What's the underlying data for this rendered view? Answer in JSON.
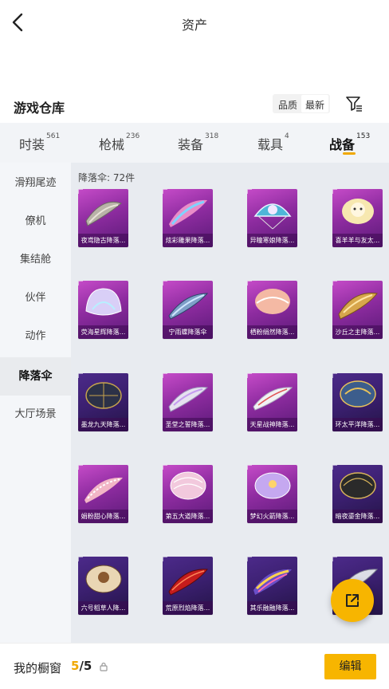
{
  "header": {
    "title": "资产",
    "back_icon": "chevron-left-icon"
  },
  "section": {
    "title": "游戏仓库",
    "sort_options": [
      "品质",
      "最新"
    ],
    "sort_active": "最新",
    "filter_icon": "filter-icon"
  },
  "tabs": [
    {
      "label": "时装",
      "count": "561"
    },
    {
      "label": "枪械",
      "count": "236"
    },
    {
      "label": "装备",
      "count": "318"
    },
    {
      "label": "载具",
      "count": "4"
    },
    {
      "label": "战备",
      "count": "153",
      "active": true
    }
  ],
  "sidebar": [
    {
      "label": "滑翔尾迹"
    },
    {
      "label": "僚机"
    },
    {
      "label": "集结舱"
    },
    {
      "label": "伙伴"
    },
    {
      "label": "动作"
    },
    {
      "label": "降落伞",
      "active": true
    },
    {
      "label": "大厅场景"
    }
  ],
  "content": {
    "count_label": "降落伞: 72件",
    "items": [
      {
        "name": "夜鸢隐古降落...",
        "style": "purple",
        "art": "glider-gray"
      },
      {
        "name": "炫彩雕果降落...",
        "style": "purple",
        "art": "glider-pink"
      },
      {
        "name": "异瞳寒娘降落...",
        "style": "purple",
        "art": "dome-cyan"
      },
      {
        "name": "喜羊羊与友太...",
        "style": "purple",
        "art": "dome-sheep"
      },
      {
        "name": "荧海星辉降落...",
        "style": "purple",
        "art": "shell-pearl"
      },
      {
        "name": "宁雨蝶降落伞",
        "style": "purple",
        "art": "glider-blue"
      },
      {
        "name": "栖粉绢然降落...",
        "style": "purple",
        "art": "dome-peach"
      },
      {
        "name": "沙丘之主降落...",
        "style": "purple",
        "art": "glider-gold"
      },
      {
        "name": "墨龙九天降落...",
        "style": "dark",
        "art": "dome-dark"
      },
      {
        "name": "圣堂之誓降落...",
        "style": "purple",
        "art": "glider-white"
      },
      {
        "name": "天星战神降落...",
        "style": "purple",
        "art": "glider-white2"
      },
      {
        "name": "环太平洋降落...",
        "style": "dark",
        "art": "dome-jaeger"
      },
      {
        "name": "娟粉甜心降落...",
        "style": "purple",
        "art": "glider-pinkstripe"
      },
      {
        "name": "第五大道降落...",
        "style": "purple",
        "art": "dome-pink"
      },
      {
        "name": "梦幻火箭降落...",
        "style": "purple",
        "art": "dome-dream"
      },
      {
        "name": "暗夜鎏金降落...",
        "style": "dark",
        "art": "dome-blackgold"
      },
      {
        "name": "六号稻草人降...",
        "style": "dark",
        "art": "dome-scarecrow"
      },
      {
        "name": "荒原烈焰降落...",
        "style": "dark",
        "art": "glider-red"
      },
      {
        "name": "其乐融融降落...",
        "style": "dark",
        "art": "glider-colorful"
      },
      {
        "name": "",
        "style": "dark",
        "art": "glider-silver"
      }
    ]
  },
  "fab": {
    "icon": "share-external-icon"
  },
  "bottom": {
    "showcase_label": "我的橱窗",
    "showcase_current": "5",
    "showcase_separator": "/",
    "showcase_max": "5",
    "lock_icon": "lock-icon",
    "edit_label": "编辑"
  },
  "colors": {
    "accent": "#f7b500",
    "card_purple": "#a23bb3",
    "card_dark": "#3a1f6e"
  }
}
